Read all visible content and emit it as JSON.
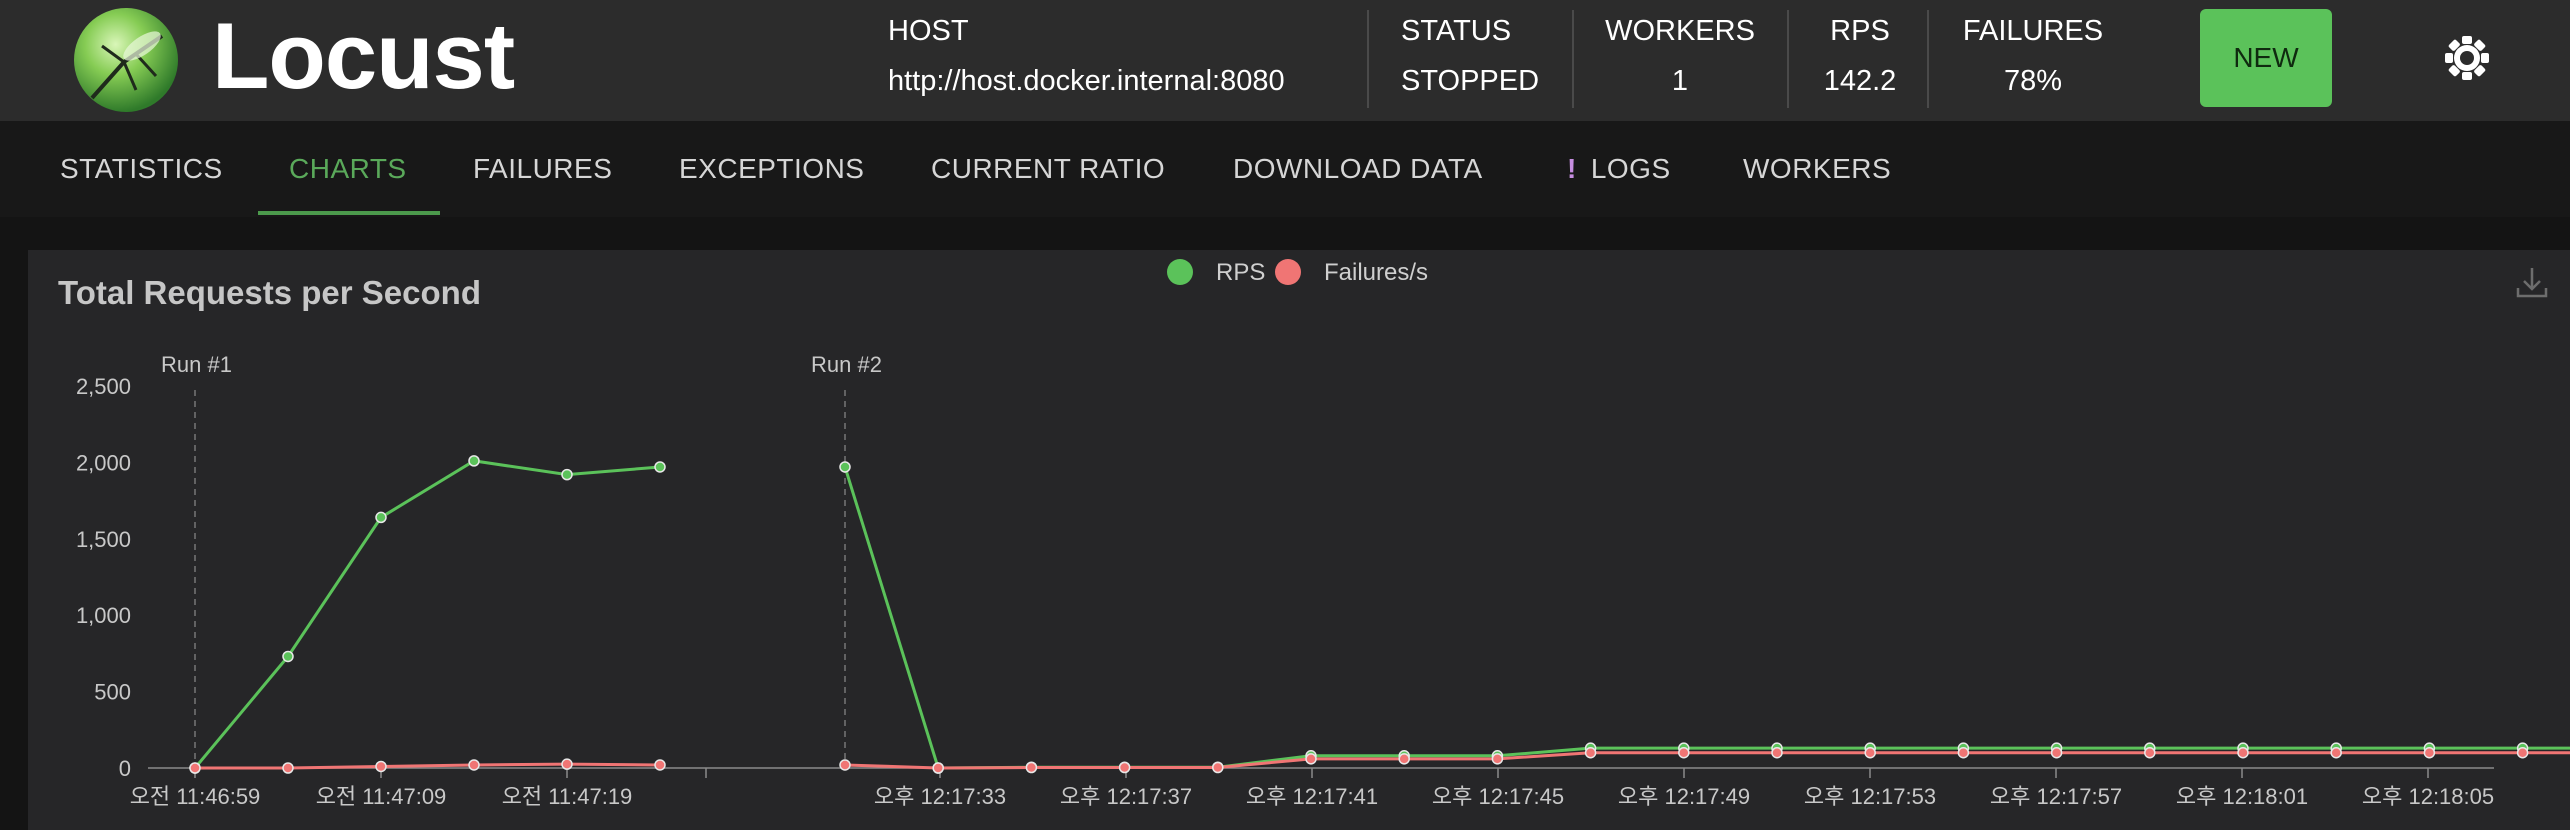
{
  "header": {
    "app_name": "Locust",
    "host_label": "HOST",
    "host_value": "http://host.docker.internal:8080",
    "status_label": "STATUS",
    "status_value": "STOPPED",
    "workers_label": "WORKERS",
    "workers_value": "1",
    "rps_label": "RPS",
    "rps_value": "142.2",
    "failures_label": "FAILURES",
    "failures_value": "78%",
    "new_button": "NEW",
    "theme_icon": "sun-icon"
  },
  "tabs": [
    {
      "label": "STATISTICS",
      "active": false
    },
    {
      "label": "CHARTS",
      "active": true
    },
    {
      "label": "FAILURES",
      "active": false
    },
    {
      "label": "EXCEPTIONS",
      "active": false
    },
    {
      "label": "CURRENT RATIO",
      "active": false
    },
    {
      "label": "DOWNLOAD DATA",
      "active": false
    },
    {
      "label": "LOGS",
      "active": false,
      "alert_icon": "!"
    },
    {
      "label": "WORKERS",
      "active": false
    }
  ],
  "colors": {
    "accent": "#5aa95a",
    "rps": "#5bc25a",
    "failures": "#f07574",
    "new_button": "#5bc25a",
    "logs_alert": "#c68ee0"
  },
  "chart_data": {
    "type": "line",
    "title": "Total Requests per Second",
    "legend": [
      "RPS",
      "Failures/s"
    ],
    "legend_position": "top-center",
    "grid": false,
    "ylim": [
      0,
      2500
    ],
    "y_ticks": [
      "0",
      "500",
      "1,000",
      "1,500",
      "2,000",
      "2,500"
    ],
    "x_tick_labels": [
      "오전 11:46:59",
      "오전 11:47:09",
      "오전 11:47:19",
      "오후 12:17:33",
      "오후 12:17:37",
      "오후 12:17:41",
      "오후 12:17:45",
      "오후 12:17:49",
      "오후 12:17:53",
      "오후 12:17:57",
      "오후 12:18:01",
      "오후 12:18:05"
    ],
    "annotations": [
      {
        "label": "Run #1",
        "at_point": 0
      },
      {
        "label": "Run #2",
        "at_point": 6
      }
    ],
    "series": [
      {
        "name": "RPS",
        "values": [
          0,
          730,
          1640,
          2010,
          1920,
          1970,
          1970,
          0,
          5,
          5,
          5,
          80,
          80,
          80,
          130,
          130,
          130,
          130,
          130,
          130,
          130,
          130,
          130,
          130,
          130,
          130
        ]
      },
      {
        "name": "Failures/s",
        "values": [
          0,
          0,
          10,
          20,
          25,
          20,
          20,
          0,
          3,
          3,
          3,
          60,
          60,
          60,
          100,
          100,
          100,
          100,
          100,
          100,
          100,
          100,
          100,
          100,
          100,
          100
        ]
      }
    ]
  }
}
